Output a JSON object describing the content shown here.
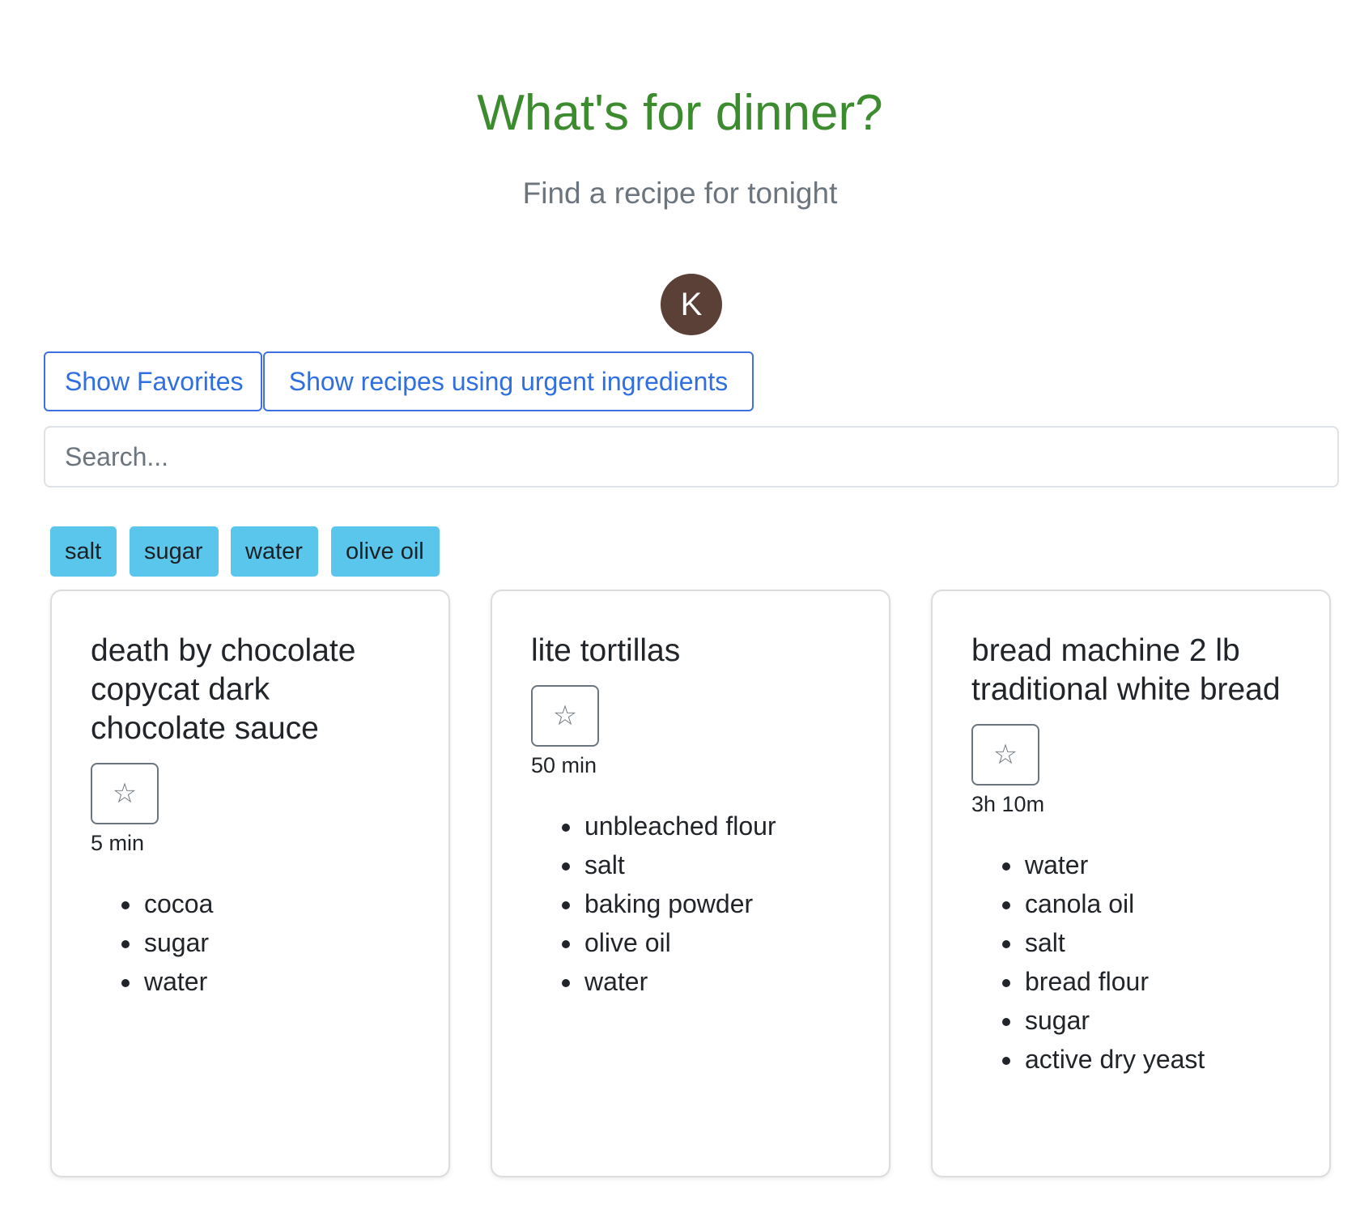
{
  "header": {
    "title": "What's for dinner?",
    "subtitle": "Find a recipe for tonight"
  },
  "user": {
    "avatar_initial": "K",
    "avatar_color": "#5b4037"
  },
  "filters": {
    "favorites_label": "Show Favorites",
    "urgent_label": "Show recipes using urgent ingredients"
  },
  "search": {
    "placeholder": "Search...",
    "value": ""
  },
  "tags": [
    "salt",
    "sugar",
    "water",
    "olive oil"
  ],
  "icons": {
    "favorite": "star-outline-icon"
  },
  "colors": {
    "title": "#3d8b2f",
    "accent": "#3b71e0",
    "tag_bg": "#5bc6ec"
  },
  "recipes": [
    {
      "title": "death by chocolate copycat dark chocolate sauce",
      "favorite_icon": "☆",
      "time": "5 min",
      "ingredients": [
        "cocoa",
        "sugar",
        "water"
      ]
    },
    {
      "title": "lite tortillas",
      "favorite_icon": "☆",
      "time": "50 min",
      "ingredients": [
        "unbleached flour",
        "salt",
        "baking powder",
        "olive oil",
        "water"
      ]
    },
    {
      "title": "bread machine 2 lb traditional white bread",
      "favorite_icon": "☆",
      "time": "3h 10m",
      "ingredients": [
        "water",
        "canola oil",
        "salt",
        "bread flour",
        "sugar",
        "active dry yeast"
      ]
    }
  ]
}
